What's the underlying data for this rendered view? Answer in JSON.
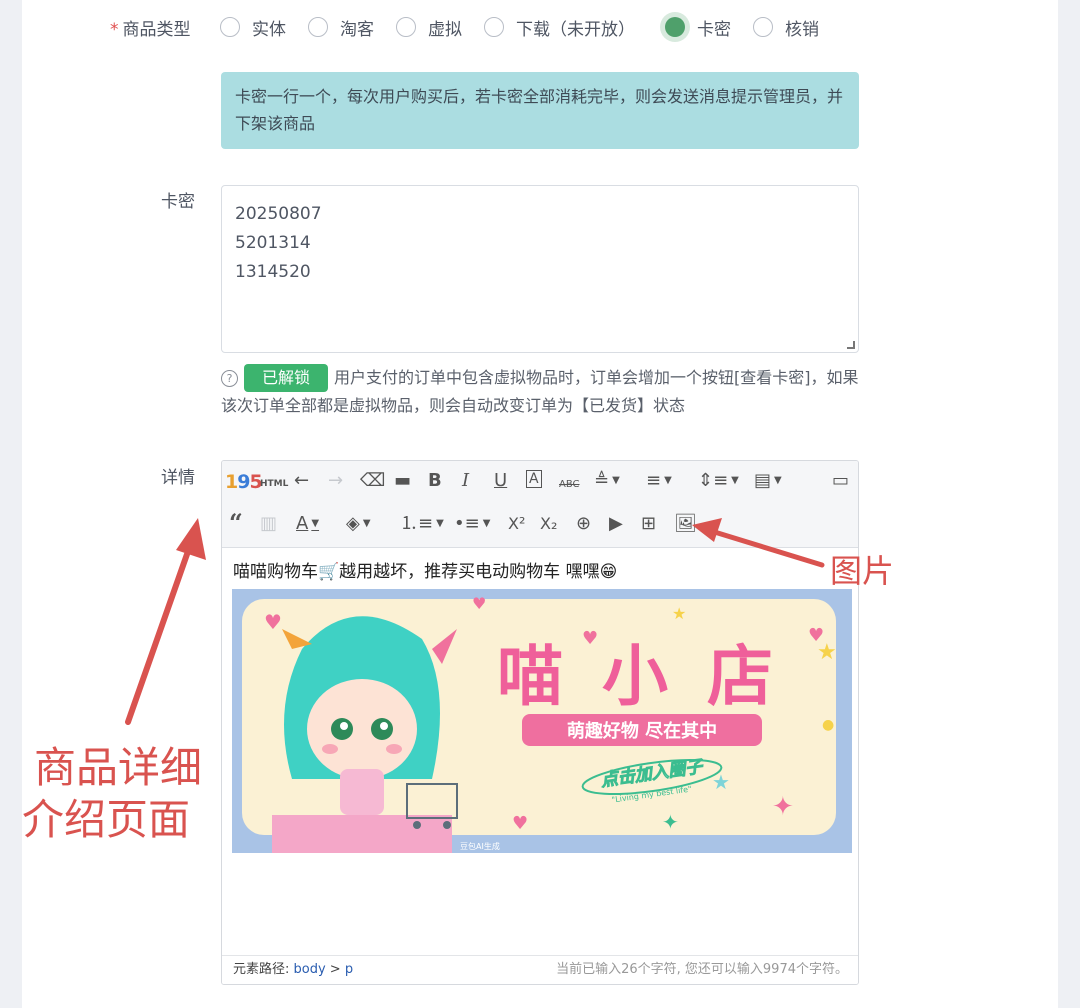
{
  "form": {
    "type_label": "商品类型",
    "required_mark": "*",
    "type_options": [
      "实体",
      "淘客",
      "虚拟",
      "下载（未开放）",
      "卡密",
      "核销"
    ],
    "type_selected": "卡密",
    "info_text": "卡密一行一个，每次用户购买后，若卡密全部消耗完毕，则会发送消息提示管理员，并下架该商品",
    "card_label": "卡密",
    "card_values": [
      "20250807",
      "5201314",
      "1314520"
    ],
    "unlock_button": "已解锁",
    "hint_text": "用户支付的订单中包含虚拟物品时，订单会增加一个按钮[查看卡密]，如果该次订单全部都是虚拟物品，则会自动改变订单为【已发货】状态",
    "detail_label": "详情"
  },
  "editor": {
    "toolbar_html_label": "HTML",
    "content_text": "喵喵购物车🛒越用越坏，推荐买电动购物车 嘿嘿😁",
    "banner": {
      "title_chars": [
        "喵",
        "小",
        "店"
      ],
      "subtitle": "萌趣好物  尽在其中",
      "slogan": "点击加入圈子",
      "small_text": "\"Living my best life\"",
      "watermark": "豆包AI生成"
    },
    "status_path_label": "元素路径: ",
    "status_path_body": "body",
    "status_path_sep": " > ",
    "status_path_p": "p",
    "status_count": "当前已输入26个字符, 您还可以输入9974个字符。"
  },
  "annotations": {
    "image_label": "图片",
    "detail_page_line1": "商品详细",
    "detail_page_line2": "介绍页面"
  },
  "colors": {
    "accent_green": "#4fa06b",
    "button_green": "#3cb46e",
    "info_bg": "#abdde1",
    "annotation_red": "#d9534f"
  }
}
